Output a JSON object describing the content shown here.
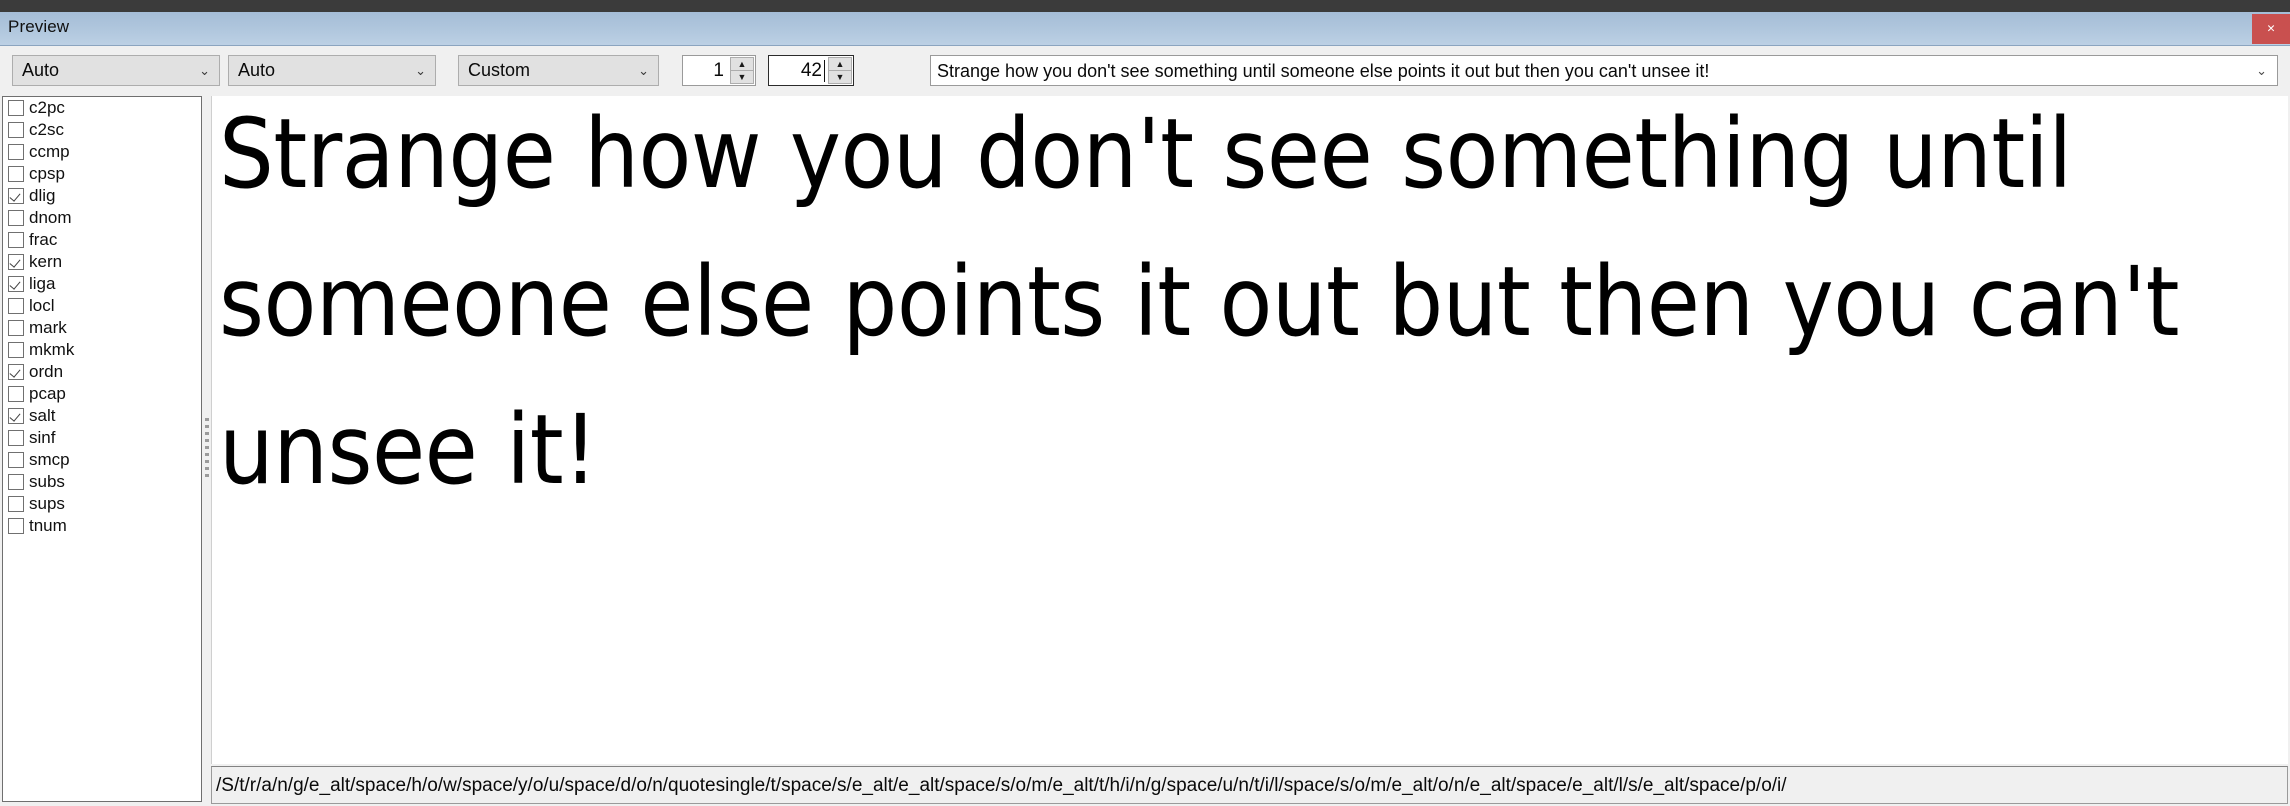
{
  "window": {
    "title": "Preview",
    "close_label": "✕",
    "close_color": "#c9504f",
    "titlebar_color": "#aec5dc",
    "top_strip_color": "#3b3b3b"
  },
  "toolbar": {
    "script_select": {
      "value": "Auto",
      "options": [
        "Auto"
      ]
    },
    "language_select": {
      "value": "Auto",
      "options": [
        "Auto"
      ]
    },
    "mode_select": {
      "value": "Custom",
      "options": [
        "Custom"
      ]
    },
    "instance_spinner": {
      "value": "1"
    },
    "size_spinner": {
      "value": "42",
      "focused": true
    },
    "sample_text_combo": {
      "value": "Strange how you don't see something until someone else points it out but then you can't unsee it!",
      "chevron": "⌄"
    },
    "chevron": "⌄"
  },
  "features": {
    "items": [
      {
        "label": "c2pc",
        "checked": false
      },
      {
        "label": "c2sc",
        "checked": false
      },
      {
        "label": "ccmp",
        "checked": false
      },
      {
        "label": "cpsp",
        "checked": false
      },
      {
        "label": "dlig",
        "checked": true
      },
      {
        "label": "dnom",
        "checked": false
      },
      {
        "label": "frac",
        "checked": false
      },
      {
        "label": "kern",
        "checked": true
      },
      {
        "label": "liga",
        "checked": true
      },
      {
        "label": "locl",
        "checked": false
      },
      {
        "label": "mark",
        "checked": false
      },
      {
        "label": "mkmk",
        "checked": false
      },
      {
        "label": "ordn",
        "checked": true
      },
      {
        "label": "pcap",
        "checked": false
      },
      {
        "label": "salt",
        "checked": true
      },
      {
        "label": "sinf",
        "checked": false
      },
      {
        "label": "smcp",
        "checked": false
      },
      {
        "label": "subs",
        "checked": false
      },
      {
        "label": "sups",
        "checked": false
      },
      {
        "label": "tnum",
        "checked": false
      }
    ]
  },
  "preview": {
    "text": "Strange how you don't see something until someone else points it out but then you can't unsee it!"
  },
  "statusbar": {
    "glyph_path": "/S/t/r/a/n/g/e_alt/space/h/o/w/space/y/o/u/space/d/o/n/quotesingle/t/space/s/e_alt/e_alt/space/s/o/m/e_alt/t/h/i/n/g/space/u/n/t/i/l/space/s/o/m/e_alt/o/n/e_alt/space/e_alt/l/s/e_alt/space/p/o/i/"
  }
}
